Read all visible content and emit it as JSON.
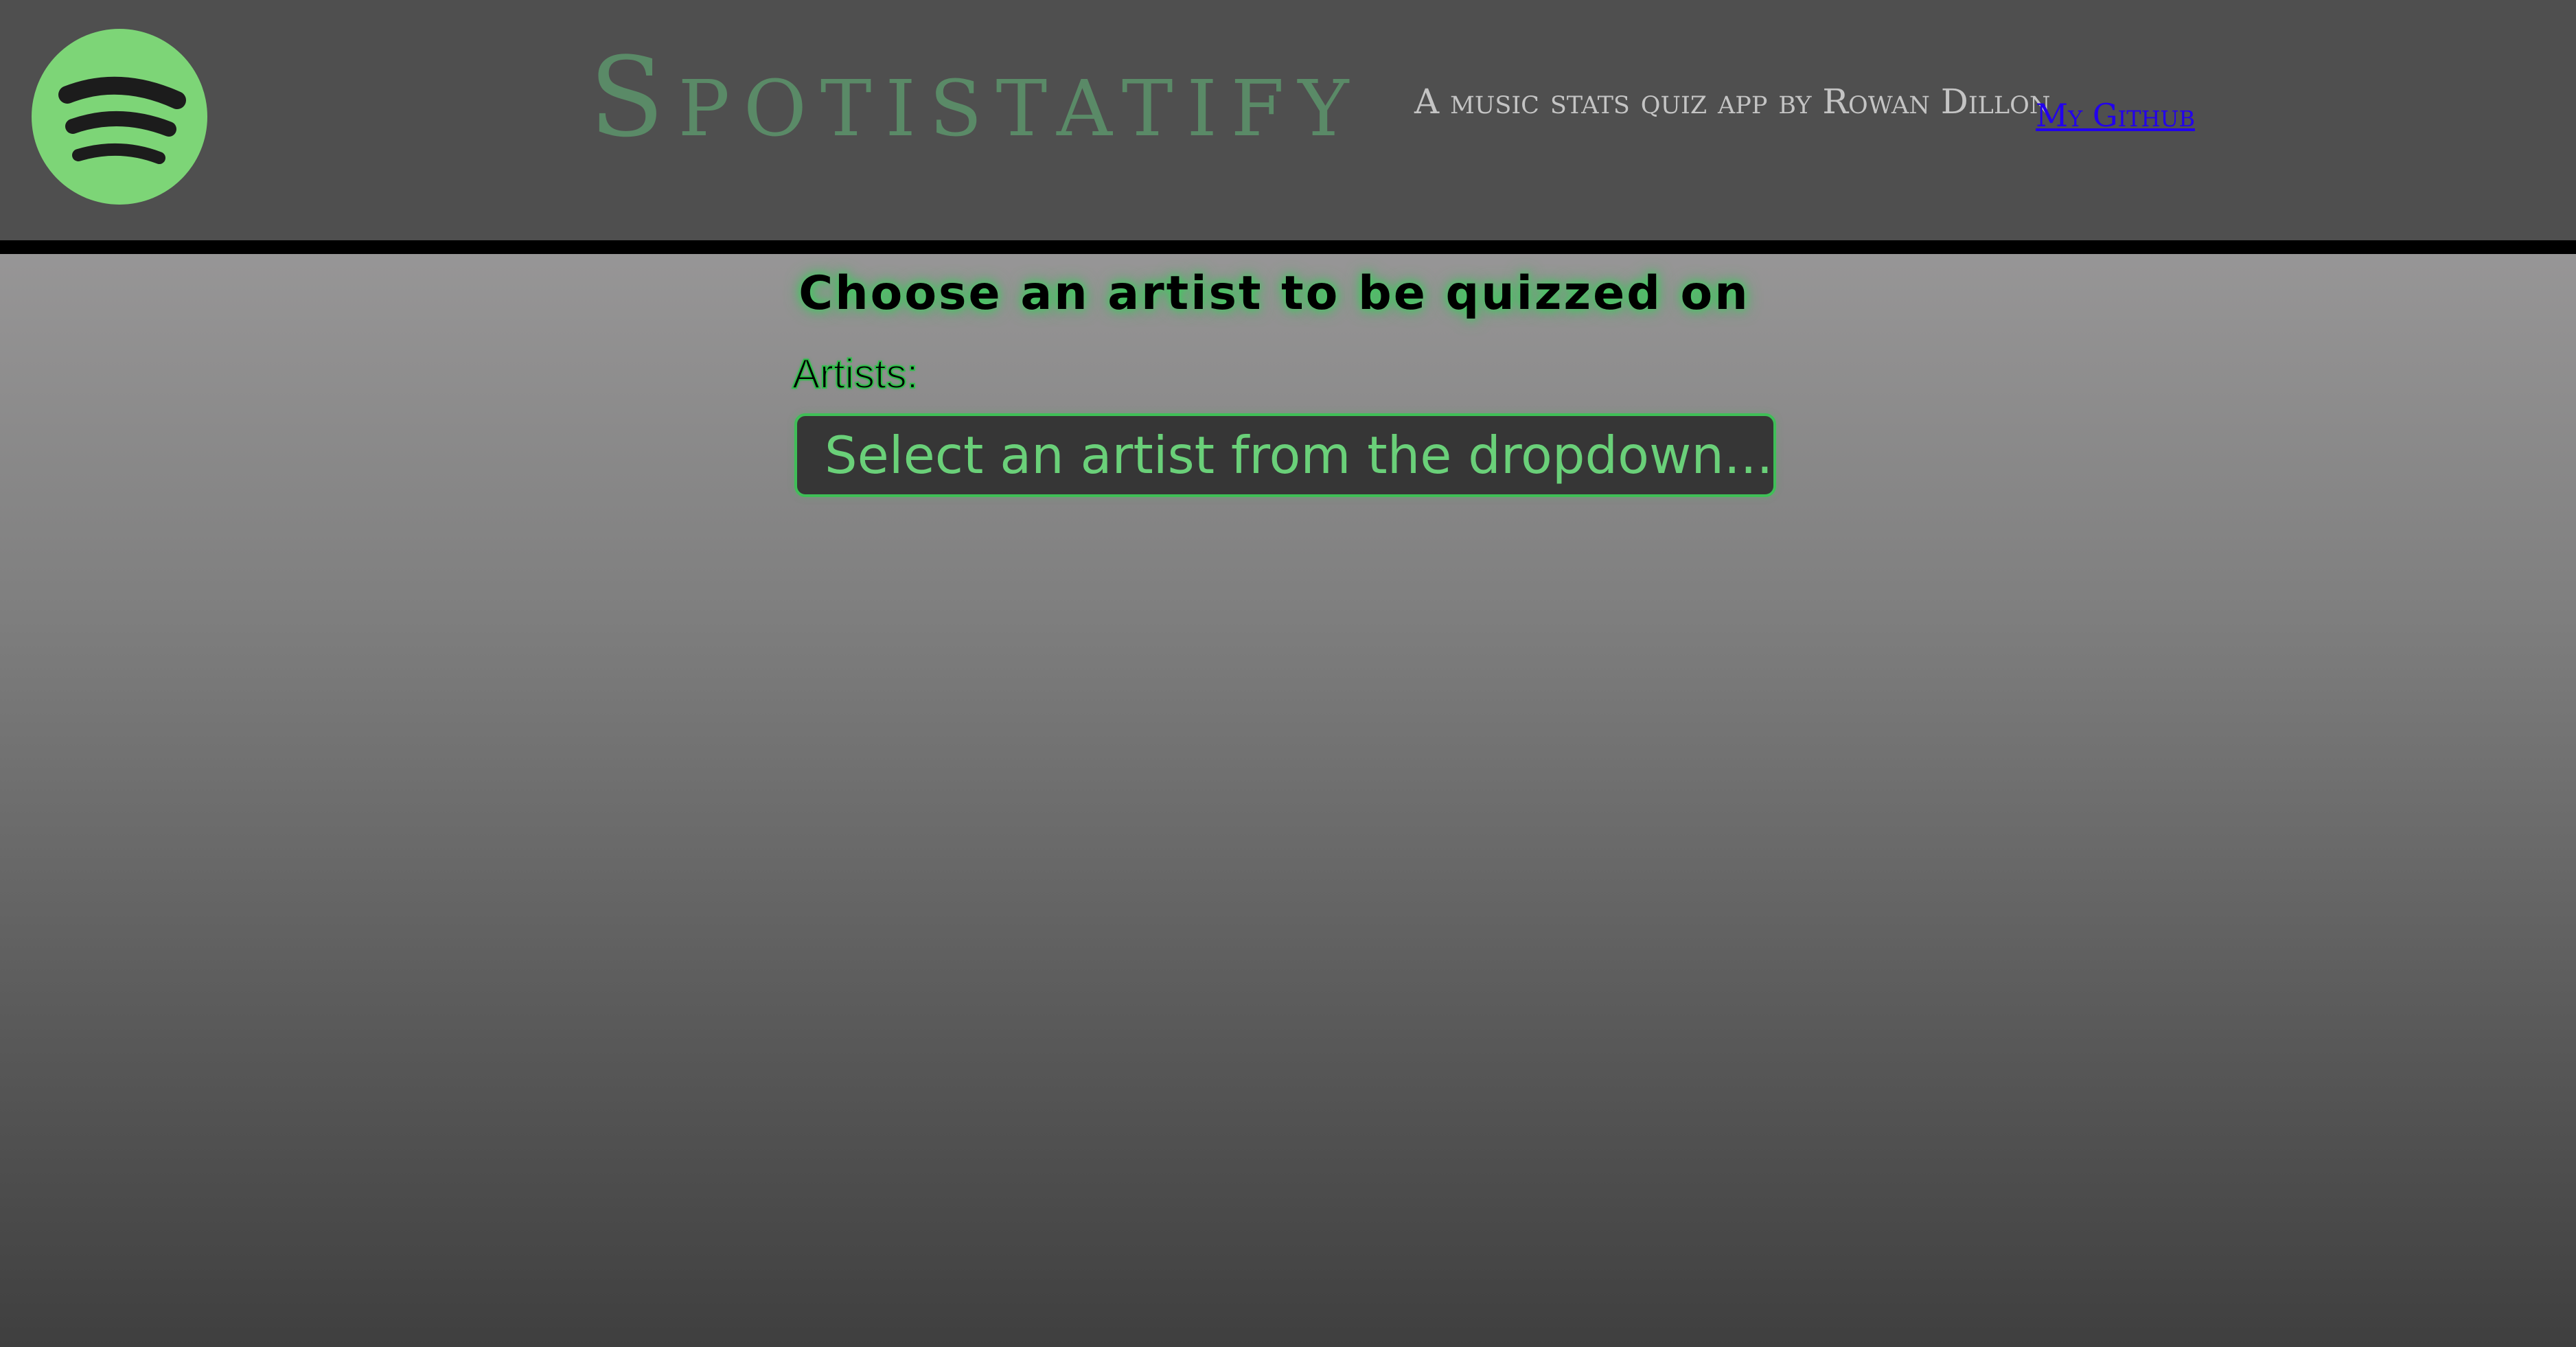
{
  "header": {
    "logo_icon": "spotify-logo-icon",
    "title": "Spotistatify",
    "subtitle": "A music stats quiz app by Rowan Dillon",
    "github_link": "My Github"
  },
  "main": {
    "heading": "Choose an artist to be quizzed on",
    "artists_label": "Artists:",
    "artist_select": {
      "placeholder": "Select an artist from the dropdown..."
    }
  },
  "colors": {
    "header_background": "#4f4f4f",
    "header_rule": "#000000",
    "logo_green": "#7dd577",
    "title_green": "#5a8a67",
    "accent_green": "#3fbf57",
    "select_background": "#363636",
    "select_text": "#6ad079",
    "link_blue": "#2200ee"
  }
}
